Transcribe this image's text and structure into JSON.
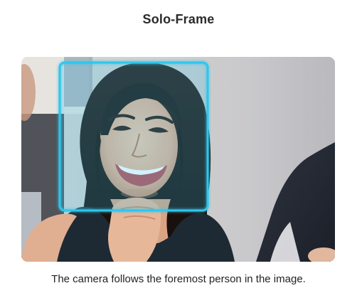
{
  "title": "Solo-Frame",
  "image": {
    "subject": "smiling-woman-portrait",
    "frame_color": "#2fc6ec"
  },
  "caption": "The camera follows the foremost person in the image."
}
